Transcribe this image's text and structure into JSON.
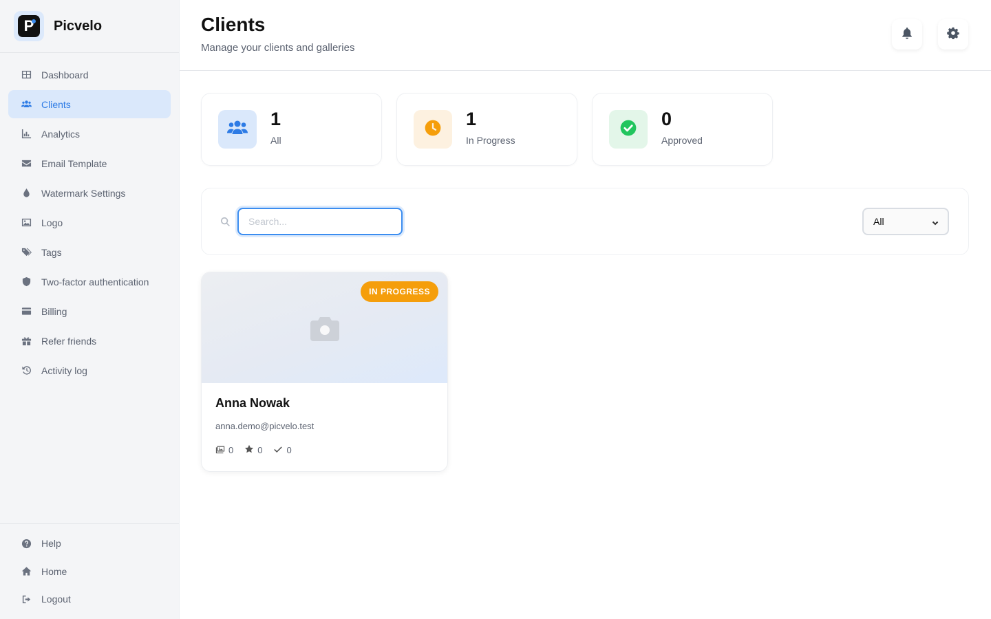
{
  "brand": {
    "name": "Picvelo",
    "logo_letter": "P"
  },
  "sidebar": {
    "items": [
      {
        "label": "Dashboard",
        "icon": "dashboard-icon",
        "active": false
      },
      {
        "label": "Clients",
        "icon": "users-icon",
        "active": true
      },
      {
        "label": "Analytics",
        "icon": "chart-icon",
        "active": false
      },
      {
        "label": "Email Template",
        "icon": "envelope-icon",
        "active": false
      },
      {
        "label": "Watermark Settings",
        "icon": "droplet-icon",
        "active": false
      },
      {
        "label": "Logo",
        "icon": "image-icon",
        "active": false
      },
      {
        "label": "Tags",
        "icon": "tags-icon",
        "active": false
      },
      {
        "label": "Two-factor authentication",
        "icon": "shield-icon",
        "active": false
      },
      {
        "label": "Billing",
        "icon": "credit-card-icon",
        "active": false
      },
      {
        "label": "Refer friends",
        "icon": "gift-icon",
        "active": false
      },
      {
        "label": "Activity log",
        "icon": "history-icon",
        "active": false
      }
    ],
    "bottom_items": [
      {
        "label": "Help",
        "icon": "help-icon"
      },
      {
        "label": "Home",
        "icon": "home-icon"
      },
      {
        "label": "Logout",
        "icon": "logout-icon"
      }
    ]
  },
  "header": {
    "title": "Clients",
    "subtitle": "Manage your clients and galleries",
    "buttons": [
      "bell-icon",
      "gear-icon"
    ]
  },
  "stats": [
    {
      "value": "1",
      "label": "All",
      "icon": "users-icon",
      "color": "#2d7be5",
      "bg": "#dae8fb"
    },
    {
      "value": "1",
      "label": "In Progress",
      "icon": "clock-icon",
      "color": "#f59e0b",
      "bg": "#fdf1e0"
    },
    {
      "value": "0",
      "label": "Approved",
      "icon": "check-circle-icon",
      "color": "#22c55e",
      "bg": "#e3f6e9"
    }
  ],
  "filter": {
    "search_placeholder": "Search...",
    "search_value": "",
    "select_value": "All"
  },
  "clients": [
    {
      "name": "Anna Nowak",
      "email": "anna.demo@picvelo.test",
      "status": "IN PROGRESS",
      "photos": "0",
      "favorites": "0",
      "approved": "0"
    }
  ],
  "colors": {
    "accent": "#2d7be5",
    "in_progress": "#f59e0b",
    "approved": "#22c55e"
  }
}
